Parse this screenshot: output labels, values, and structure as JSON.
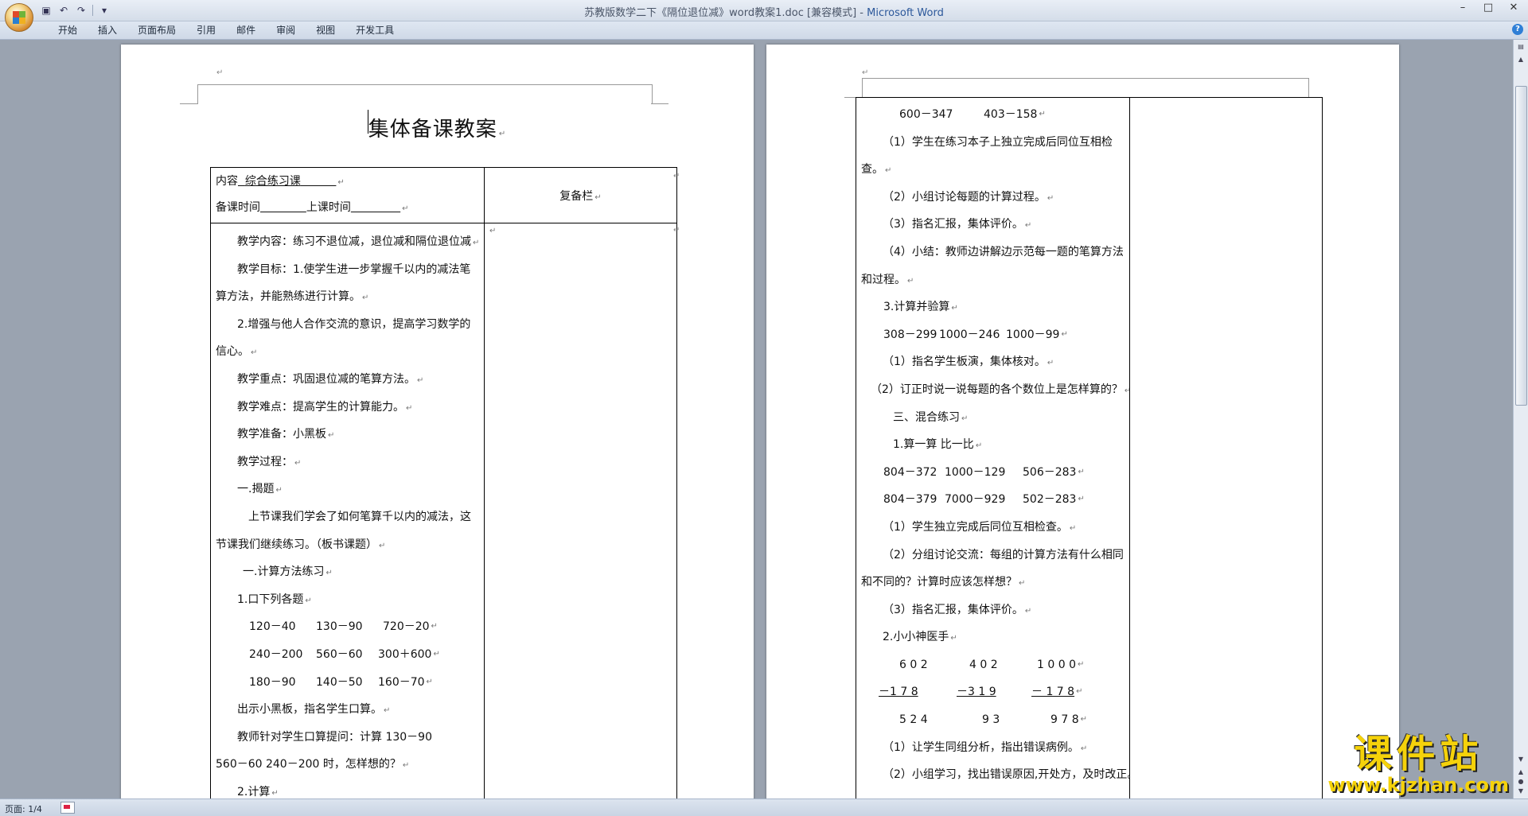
{
  "window": {
    "title": "苏教版数学二下《隔位退位减》word教案1.doc [兼容模式] - ",
    "app_name": "Microsoft Word",
    "controls": [
      "–",
      "□",
      "✕"
    ]
  },
  "ribbon": {
    "tabs": [
      "开始",
      "插入",
      "页面布局",
      "引用",
      "邮件",
      "审阅",
      "视图",
      "开发工具"
    ],
    "help": "?"
  },
  "page1": {
    "title": "集体备课教案",
    "header_row": {
      "content_label": "内容",
      "content_value": "综合练习课",
      "prep_time_label": "备课时间",
      "class_time_label": "上课时间",
      "review_column": "复备栏"
    },
    "lines": [
      "教学内容：练习不退位减，退位减和隔位退位减",
      "教学目标：1.使学生进一步掌握千以内的减法笔",
      "算方法，并能熟练进行计算。",
      "2.增强与他人合作交流的意识，提高学习数学的",
      "信心。",
      "教学重点：巩固退位减的笔算方法。",
      "教学难点：提高学生的计算能力。",
      "教学准备：小黑板",
      "教学过程：",
      "一.揭题",
      "上节课我们学会了如何笔算千以内的减法，这",
      "节课我们继续练习。（板书课题）",
      "一.计算方法练习",
      "1.口下列各题",
      [
        "120－40",
        "130－90",
        "720－20"
      ],
      [
        "240－200",
        "560－60",
        "300＋600"
      ],
      [
        "180－90",
        "140－50",
        "160－70"
      ],
      "出示小黑板，指名学生口算。",
      "教师针对学生口算提问：计算  130－90",
      "560－60      240－200 时，怎样想的？",
      "2.计算"
    ]
  },
  "page2": {
    "lines": [
      [
        "600－347",
        "403－158"
      ],
      "（1）学生在练习本子上独立完成后同位互相检",
      "查。",
      "（2）小组讨论每题的计算过程。",
      "（3）指名汇报，集体评价。",
      "（4）小结：教师边讲解边示范每一题的笔算方法",
      "和过程。",
      "3.计算并验算",
      [
        "308－299",
        "1000－246",
        "1000－99"
      ],
      "（1）指名学生板演，集体核对。",
      "（2）订正时说一说每题的各个数位上是怎样算的？",
      "三、混合练习",
      "1.算一算   比一比",
      [
        "804－372",
        "1000－129",
        "506－283"
      ],
      [
        "804－379",
        "7000－929",
        "502－283"
      ],
      "（1）学生独立完成后同位互相检查。",
      "（2）分组讨论交流：每组的计算方法有什么相同",
      "和不同的？计算时应该怎样想？",
      "（3）指名汇报，集体评价。",
      "2.小小神医手",
      [
        "6  0  2",
        "4  0  2",
        "1  0  0  0"
      ],
      [
        "－1  7  8",
        "－3  1  9",
        "－  1  7  8"
      ],
      [
        "5  2  4",
        "9  3",
        "9  7  8"
      ],
      "（1）让学生同组分析，指出错误病例。",
      "（2）小组学习，找出错误原因,开处方，及时改正。"
    ]
  },
  "status": {
    "page": "页面: 1/4"
  },
  "watermark": {
    "cn": "课件站",
    "url": "www.kjzhan.com"
  },
  "marks": {
    "para": "↵"
  }
}
